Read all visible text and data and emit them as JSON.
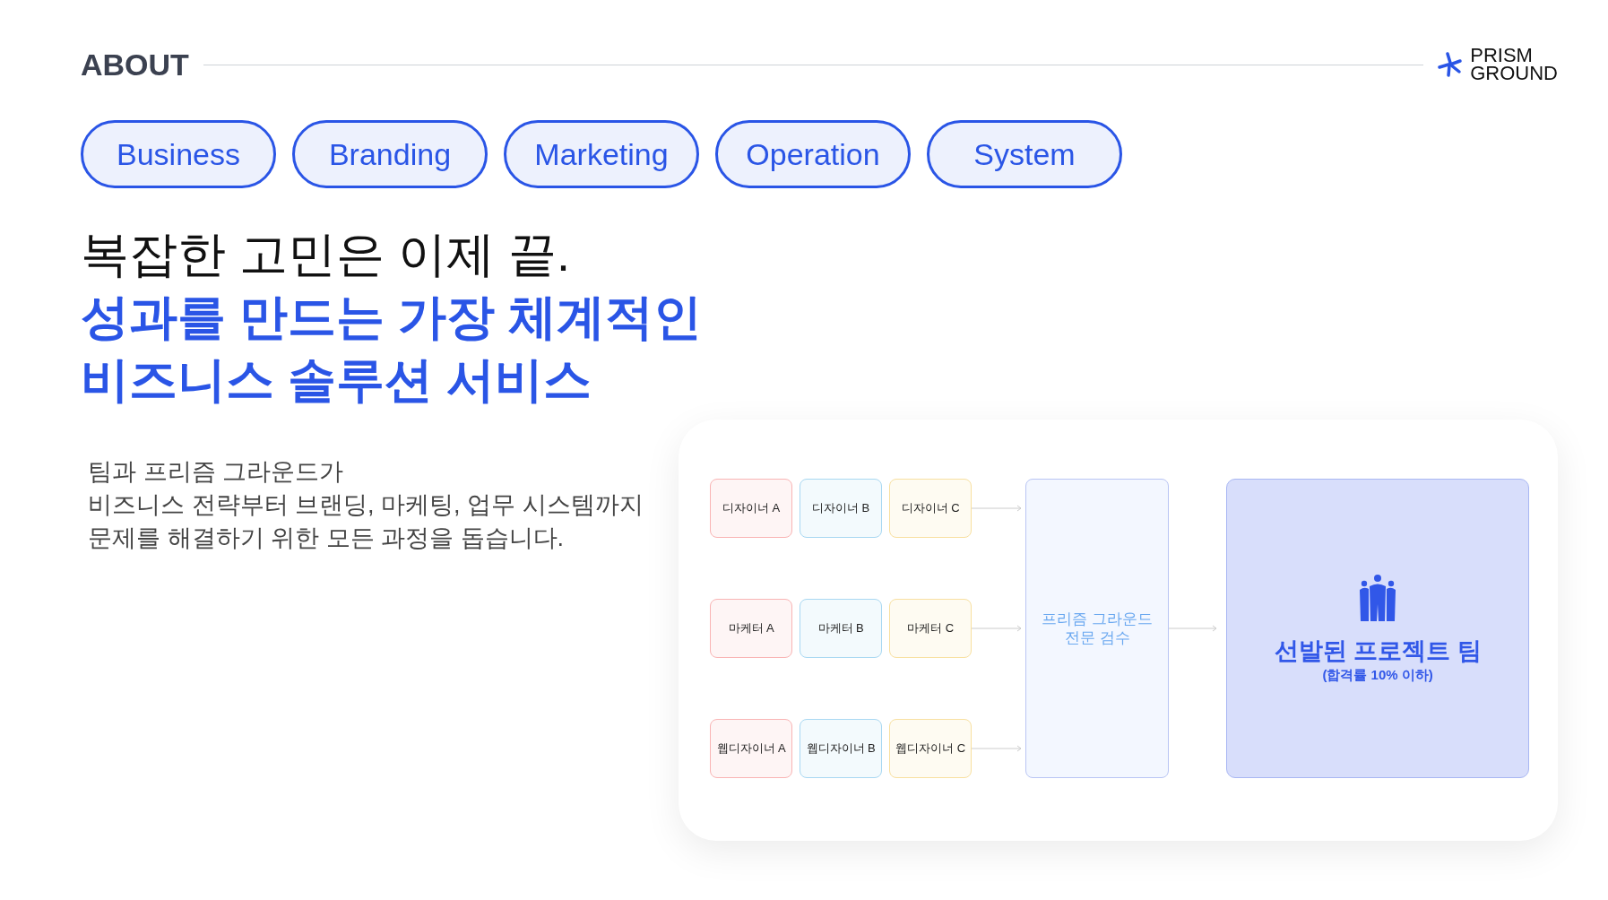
{
  "header": {
    "title": "ABOUT",
    "logo": [
      "PRISM",
      "GROUND"
    ]
  },
  "tags": [
    "Business",
    "Branding",
    "Marketing",
    "Operation",
    "System"
  ],
  "headline": {
    "lead": "복잡한 고민은 이제 끝.",
    "highlight": [
      "성과를 만드는 가장 체계적인",
      "비즈니스 솔루션 서비스"
    ]
  },
  "description": [
    "팀과 프리즘 그라운드가",
    "비즈니스 전략부터 브랜딩, 마케팅, 업무 시스템까지",
    "문제를 해결하기 위한 모든 과정을 돕습니다."
  ],
  "diagram": {
    "rows": [
      [
        {
          "label": "디자이너 A",
          "color": "#f9b4b4"
        },
        {
          "label": "디자이너 B",
          "color": "#a8d8f2"
        },
        {
          "label": "디자이너 C",
          "color": "#f8e0a0"
        }
      ],
      [
        {
          "label": "마케터 A",
          "color": "#f9b4b4"
        },
        {
          "label": "마케터 B",
          "color": "#a8d8f2"
        },
        {
          "label": "마케터 C",
          "color": "#f8e0a0"
        }
      ],
      [
        {
          "label": "웹디자이너 A",
          "color": "#f9b4b4"
        },
        {
          "label": "웹디자이너 B",
          "color": "#a8d8f2"
        },
        {
          "label": "웹디자이너 C",
          "color": "#f8e0a0"
        }
      ]
    ],
    "review": [
      "프리즘 그라운드",
      "전문 검수"
    ],
    "result": {
      "title": "선발된 프로젝트 팀",
      "note": "(합격률 10% 이하)"
    }
  }
}
